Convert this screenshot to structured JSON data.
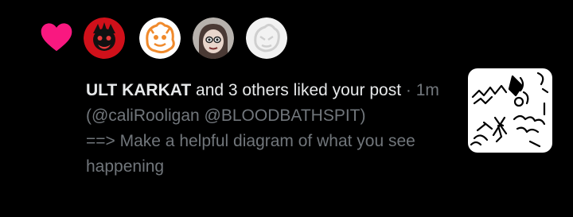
{
  "notification": {
    "icon": "heart-icon",
    "accent_color": "#f91880",
    "avatars": [
      {
        "name": "avatar-red-icon",
        "color": "#d0101a"
      },
      {
        "name": "avatar-orange-icon",
        "color": "#f08a2c"
      },
      {
        "name": "avatar-portrait-icon",
        "color": "#b7b2ad"
      },
      {
        "name": "avatar-white-icon",
        "color": "#f2f2f2"
      }
    ],
    "actor": "ULT KARKAT",
    "action": " and 3 others liked your post",
    "separator": " · ",
    "timestamp": "1m",
    "mentions": "(@caliRooligan @BLOODBATHSPIT)",
    "message": "==> Make a helpful diagram of what you see happening",
    "thumbnail_icon": "doodle-thumbnail-icon"
  }
}
